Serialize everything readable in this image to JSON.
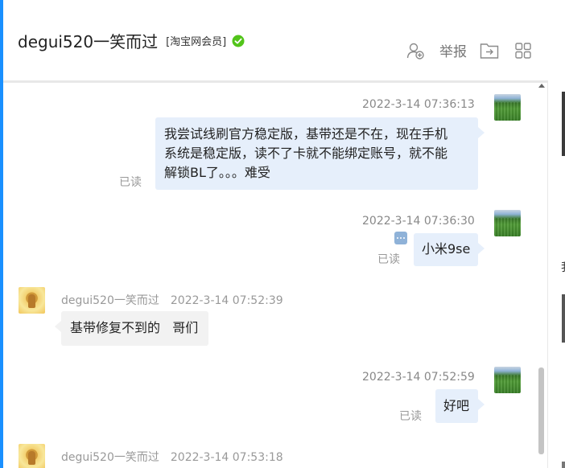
{
  "header": {
    "contact_name": "degui520一笑而过",
    "member_badge": "[淘宝网会员]",
    "report_label": "举报"
  },
  "colors": {
    "accent": "#1a90ff",
    "my_bubble": "#e6effb",
    "other_bubble": "#f2f2f2",
    "verified": "#52c41a",
    "muted_text": "#999999"
  },
  "icons": [
    "verified-check-icon",
    "add-contact-icon",
    "move-to-folder-icon",
    "grid-apps-icon",
    "more-dots-icon"
  ],
  "messages": [
    {
      "from": "me",
      "time": "2022-3-14 07:36:13",
      "lines": [
        "我尝试线刷官方稳定版，基带还是不在，现在手机",
        "系统是稳定版，读不了卡就不能绑定账号，就不能",
        "解锁BL了。。。难受"
      ],
      "status": "已读"
    },
    {
      "from": "me",
      "time": "2022-3-14 07:36:30",
      "text": "小米9se",
      "status": "已读"
    },
    {
      "from": "other",
      "sender": "degui520一笑而过",
      "time": "2022-3-14 07:52:39",
      "text": "基带修复不到的   哥们"
    },
    {
      "from": "me",
      "time": "2022-3-14 07:52:59",
      "text": "好吧",
      "status": "已读"
    },
    {
      "from": "other",
      "sender": "degui520一笑而过",
      "time": "2022-3-14 07:53:18"
    }
  ],
  "side_panel": {
    "glyph": "我"
  }
}
